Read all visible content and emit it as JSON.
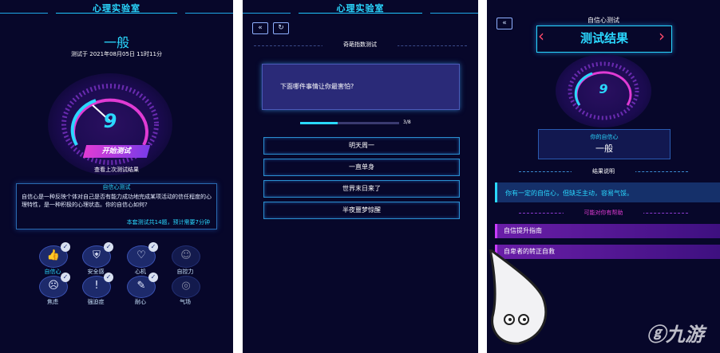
{
  "panel1": {
    "header_title": "心理实验室",
    "result_word": "一般",
    "test_time": "测试于 2021年08月05日 11时11分",
    "gauge_value": "9",
    "start_button": "开始测试",
    "view_last": "查看上次测试结果",
    "info_title": "自信心测试",
    "info_body": "自信心是一种反映个体对自己是否有能力成功地完成某项活动的信任程度的心理特性，是一种积极的心理状态。你的自信心如何?",
    "info_footer": "本套测试共14题，预计需要7分钟",
    "tests": [
      {
        "label": "自信心",
        "icon": "thumbs-up-icon",
        "glyph": "👍",
        "done": true,
        "active": true
      },
      {
        "label": "安全感",
        "icon": "shield-icon",
        "glyph": "⛨",
        "done": true,
        "active": false
      },
      {
        "label": "心机",
        "icon": "heart-icon",
        "glyph": "♡",
        "done": true,
        "active": false
      },
      {
        "label": "自控力",
        "icon": "face-icon",
        "glyph": "☺",
        "done": false,
        "active": false
      },
      {
        "label": "焦虑",
        "icon": "anxiety-icon",
        "glyph": "☹",
        "done": true,
        "active": false
      },
      {
        "label": "强迫症",
        "icon": "exclamation-icon",
        "glyph": "!",
        "done": true,
        "active": false
      },
      {
        "label": "耐心",
        "icon": "pencil-icon",
        "glyph": "✎",
        "done": true,
        "active": false
      },
      {
        "label": "气场",
        "icon": "aura-icon",
        "glyph": "◎",
        "done": false,
        "active": false
      }
    ]
  },
  "panel2": {
    "header_title": "心理实验室",
    "back_icon": "«",
    "refresh_icon": "↻",
    "section_title": "奇葩指数测试",
    "question": "下面哪件事情让你最害怕?",
    "progress_text": "3/8",
    "progress_fraction": 0.375,
    "options": [
      "明天周一",
      "一直单身",
      "世界末日来了",
      "半夜噩梦惊醒"
    ]
  },
  "panel3": {
    "back_icon": "«",
    "test_name": "自信心测试",
    "result_title": "测试结果",
    "gauge_value": "9",
    "your_label": "你的自信心",
    "your_value": "一般",
    "explain_title": "结果说明",
    "explain_text": "你有一定的自信心，但缺乏主动，容易气馁。",
    "help_title": "可能对你有帮助",
    "help_items": [
      "自信提升指南",
      "自卑者的转正自救"
    ],
    "watermark_text": "九游"
  },
  "colors": {
    "background": "#07072a",
    "accent_cyan": "#2ad8ff",
    "accent_magenta": "#e03bd4",
    "accent_purple": "#6a1ea8"
  }
}
